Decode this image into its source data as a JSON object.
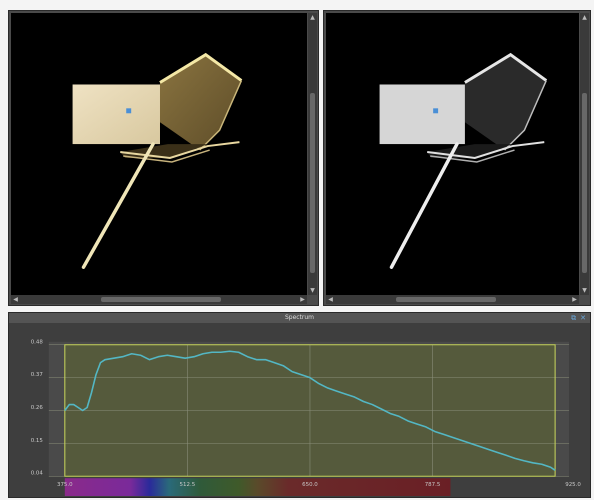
{
  "colors": {
    "viewport_bg": "#000000",
    "chrome": "#4a4a4a",
    "panel_bg": "#3e3e3e",
    "plot_fill": "#555a3c",
    "plot_border": "#c8d65a",
    "curve": "#53b7c4",
    "object_gold": "#d9c79a",
    "object_gray": "#d6d6d6",
    "marker_blue": "#4a8fd6"
  },
  "viewports": [
    {
      "name": "render-view",
      "icons": [
        "scroll-up-icon",
        "scroll-down-icon",
        "scroll-left-icon",
        "scroll-right-icon"
      ]
    },
    {
      "name": "preview-view",
      "icons": [
        "scroll-up-icon",
        "scroll-down-icon",
        "scroll-left-icon",
        "scroll-right-icon"
      ]
    }
  ],
  "panel": {
    "title": "Spectrum",
    "icons": [
      "float-icon",
      "close-icon"
    ]
  },
  "chart_data": {
    "type": "line",
    "title": "",
    "xlabel": "",
    "ylabel": "",
    "xlim": [
      375.0,
      925.0
    ],
    "ylim": [
      0.04,
      0.48
    ],
    "x_ticks": [
      "375.0",
      "512.5",
      "650.0",
      "787.5",
      "925.0"
    ],
    "y_ticks": [
      "0.48",
      "0.37",
      "0.26",
      "0.15",
      "0.04"
    ],
    "grid": true,
    "series": [
      {
        "x": [
          375,
          380,
          385,
          390,
          395,
          400,
          405,
          410,
          415,
          420,
          430,
          440,
          450,
          460,
          470,
          480,
          490,
          500,
          510,
          520,
          530,
          540,
          550,
          560,
          570,
          580,
          590,
          600,
          610,
          620,
          630,
          640,
          650,
          660,
          670,
          680,
          690,
          700,
          710,
          720,
          730,
          740,
          750,
          760,
          770,
          780,
          790,
          800,
          810,
          820,
          830,
          840,
          850,
          860,
          870,
          880,
          890,
          900,
          910,
          920,
          925
        ],
        "y": [
          0.26,
          0.28,
          0.28,
          0.27,
          0.26,
          0.27,
          0.32,
          0.38,
          0.42,
          0.43,
          0.435,
          0.44,
          0.45,
          0.445,
          0.43,
          0.44,
          0.445,
          0.44,
          0.435,
          0.44,
          0.45,
          0.455,
          0.455,
          0.458,
          0.455,
          0.44,
          0.43,
          0.43,
          0.42,
          0.41,
          0.39,
          0.38,
          0.37,
          0.35,
          0.335,
          0.325,
          0.315,
          0.305,
          0.29,
          0.28,
          0.265,
          0.25,
          0.24,
          0.225,
          0.215,
          0.205,
          0.19,
          0.18,
          0.17,
          0.16,
          0.15,
          0.14,
          0.13,
          0.12,
          0.11,
          0.1,
          0.092,
          0.085,
          0.08,
          0.07,
          0.06
        ]
      }
    ],
    "wavelength_band": {
      "from": 375.0,
      "to": 787.5
    }
  }
}
